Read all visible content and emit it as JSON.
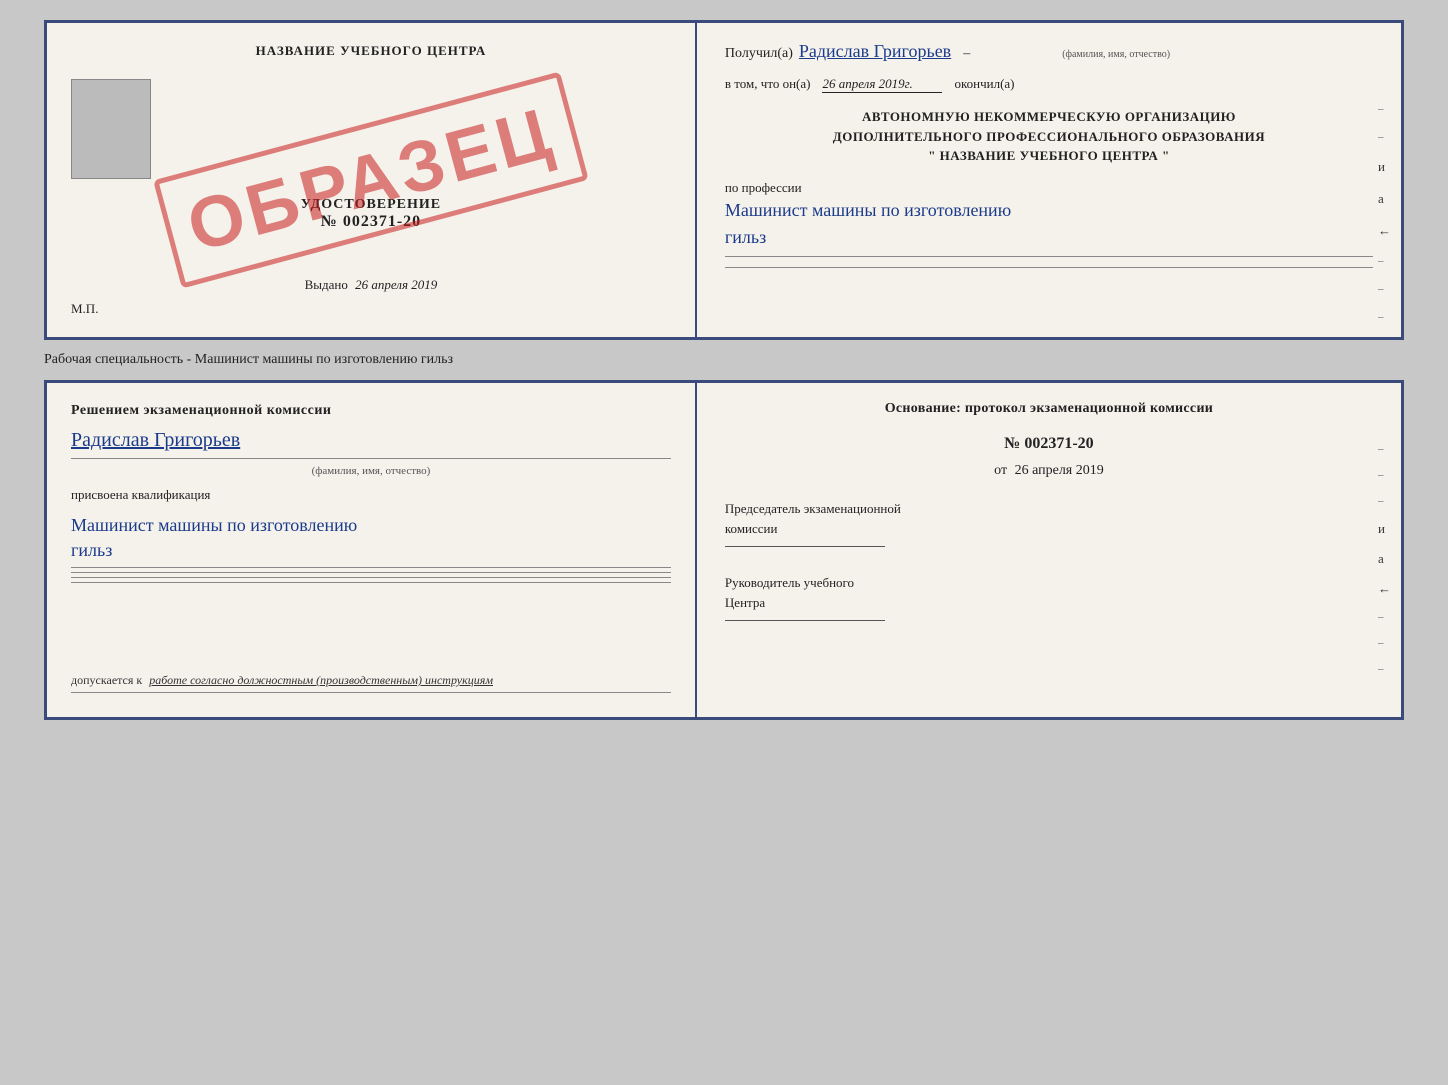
{
  "doc": {
    "top_left": {
      "center_title": "НАЗВАНИЕ УЧЕБНОГО ЦЕНТРА",
      "udostoverenie_label": "УДОСТОВЕРЕНИЕ",
      "udostoverenie_number": "№ 002371-20",
      "stamp_text": "ОБРАЗЕЦ",
      "vydano_label": "Выдано",
      "vydano_date": "26 апреля 2019",
      "mp_label": "М.П."
    },
    "top_right": {
      "poluchil_prefix": "Получил(а)",
      "poluchil_name": "Радислав Григорьев",
      "poluchil_hint": "(фамилия, имя, отчество)",
      "dash_separator": "–",
      "vtom_prefix": "в том, что он(а)",
      "vtom_date": "26 апреля 2019г.",
      "okончил_suffix": "окончил(а)",
      "org_line1": "АВТОНОМНУЮ НЕКОММЕРЧЕСКУЮ ОРГАНИЗАЦИЮ",
      "org_line2": "ДОПОЛНИТЕЛЬНОГО ПРОФЕССИОНАЛЬНОГО ОБРАЗОВАНИЯ",
      "org_line3": "\" НАЗВАНИЕ УЧЕБНОГО ЦЕНТРА \"",
      "po_professii_label": "по профессии",
      "profession_name": "Машинист машины по изготовлению",
      "profession_name2": "гильз"
    },
    "specialty_text": "Рабочая специальность - Машинист машины по изготовлению гильз",
    "bottom_left": {
      "resheniem_text": "Решением  экзаменационной  комиссии",
      "name_handwritten": "Радислав Григорьев",
      "name_hint": "(фамилия, имя, отчество)",
      "prisvoena_text": "присвоена квалификация",
      "qualification_line1": "Машинист машины по изготовлению",
      "qualification_line2": "гильз",
      "dopuskaetsya_prefix": "допускается к",
      "dopuskaetsya_text": "работе согласно должностным (производственным) инструкциям"
    },
    "bottom_right": {
      "osnovanie_title": "Основание: протокол экзаменационной  комиссии",
      "protocol_number": "№  002371-20",
      "protocol_date_prefix": "от",
      "protocol_date": "26 апреля 2019",
      "predsedatel_title": "Председатель экзаменационной",
      "predsedatel_subtitle": "комиссии",
      "rukovoditel_title": "Руководитель учебного",
      "rukovoditel_subtitle": "Центра"
    },
    "right_dashes": [
      "-",
      "–",
      "и",
      "а",
      "←",
      "–"
    ],
    "right_dashes_bottom": [
      "-",
      "–",
      "и",
      "а",
      "←",
      "–",
      "-",
      "-"
    ]
  }
}
